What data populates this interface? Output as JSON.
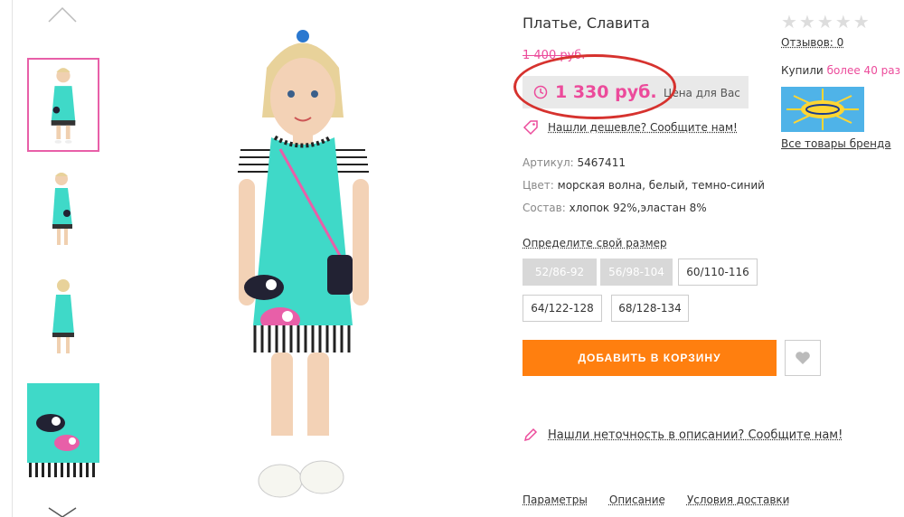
{
  "product": {
    "title": "Платье, Славита",
    "old_price": "1 400 руб.",
    "price": "1 330 руб.",
    "price_note": "Цена для Вас",
    "cheaper_link": "Нашли дешевле? Сообщите нам!",
    "attributes": [
      {
        "label": "Артикул:",
        "value": "5467411"
      },
      {
        "label": "Цвет:",
        "value": "морская волна, белый, темно-синий"
      },
      {
        "label": "Состав:",
        "value": "хлопок 92%,эластан 8%"
      }
    ],
    "size_link": "Определите свой размер",
    "sizes": [
      {
        "label": "52/86-92",
        "available": false
      },
      {
        "label": "56/98-104",
        "available": false
      },
      {
        "label": "60/110-116",
        "available": true
      },
      {
        "label": "64/122-128",
        "available": true
      },
      {
        "label": "68/128-134",
        "available": true
      }
    ],
    "add_to_cart": "ДОБАВИТЬ В КОРЗИНУ",
    "inaccuracy_link": "Нашли неточность в описании? Сообщите нам!",
    "tabs": [
      "Параметры",
      "Описание",
      "Условия доставки"
    ]
  },
  "sidebar": {
    "rating": 0,
    "reviews": "Отзывов: 0",
    "bought_prefix": "Купили",
    "bought_count": "более 40 раз",
    "brand_link": "Все товары бренда"
  },
  "icons": {
    "chevron_up": "chevron-up-icon",
    "chevron_down": "chevron-down-icon",
    "clock": "clock-icon",
    "tag": "tag-icon",
    "heart": "heart-icon",
    "pencil": "pencil-icon",
    "star": "star-icon"
  },
  "colors": {
    "accent_pink": "#ec4b9b",
    "cart_orange": "#ff7f0f",
    "annotation_red": "#d6322e",
    "dress_turquoise": "#3fd9c8"
  }
}
